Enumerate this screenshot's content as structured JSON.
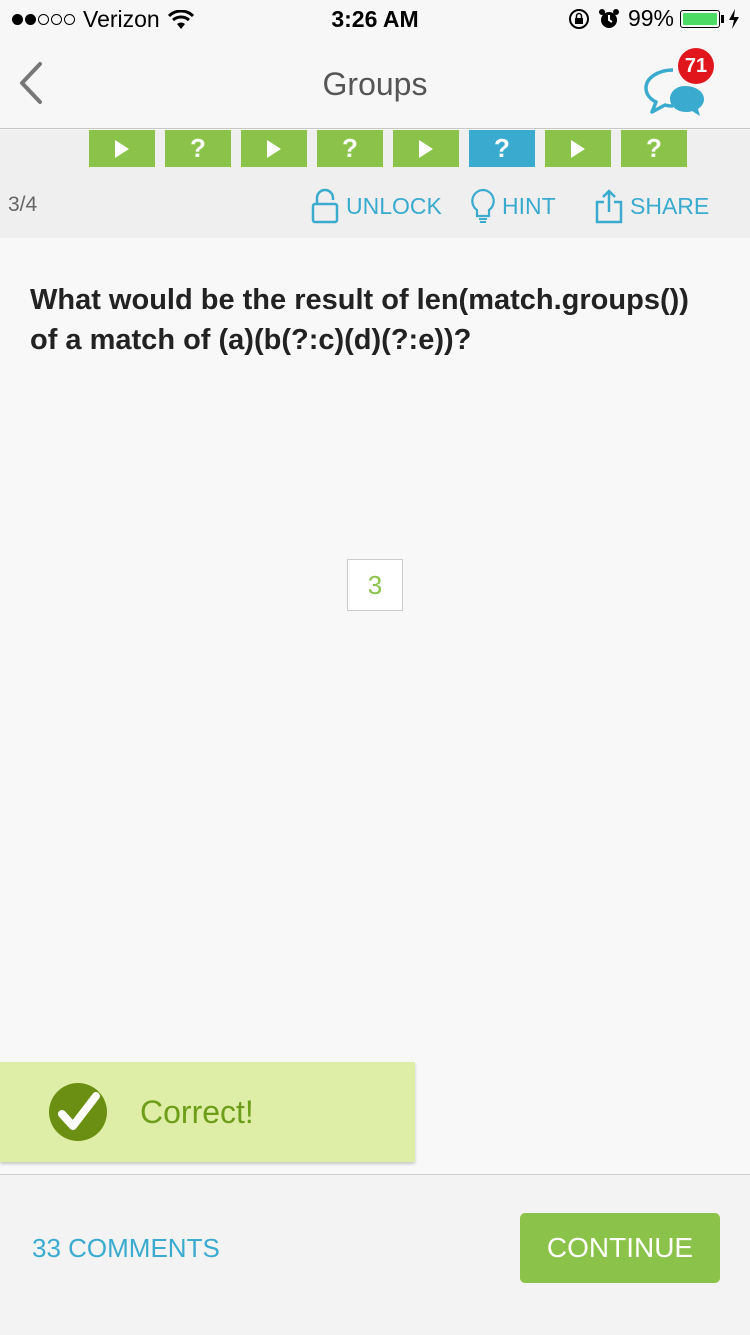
{
  "status_bar": {
    "carrier": "Verizon",
    "time": "3:26 AM",
    "battery": "99%",
    "battery_level": 0.99,
    "signal_bars_filled": 2,
    "signal_bars_total": 5
  },
  "nav": {
    "title": "Groups",
    "back_icon": "chevron-left-icon",
    "chat_icon": "chat-bubbles-icon",
    "badge_count": "71"
  },
  "progress": {
    "steps": [
      {
        "type": "play",
        "label": ""
      },
      {
        "type": "question",
        "label": "?"
      },
      {
        "type": "play",
        "label": ""
      },
      {
        "type": "question",
        "label": "?"
      },
      {
        "type": "play",
        "label": ""
      },
      {
        "type": "question",
        "label": "?",
        "current": true
      },
      {
        "type": "play",
        "label": ""
      },
      {
        "type": "question",
        "label": "?"
      }
    ],
    "counter": "3/4"
  },
  "actions": {
    "unlock": "UNLOCK",
    "hint": "HINT",
    "share": "SHARE"
  },
  "question": {
    "text": "What would be the result of len(match.groups()) of a match of (a)(b(?:c)(d)(?:e))?"
  },
  "answer": {
    "value": "3"
  },
  "feedback": {
    "text": "Correct!"
  },
  "footer": {
    "comments": "33 COMMENTS",
    "continue": "CONTINUE"
  },
  "colors": {
    "green": "#8bc34a",
    "blue": "#3aabce",
    "badge_red": "#e0161c",
    "toast_bg": "#dfeea6"
  }
}
